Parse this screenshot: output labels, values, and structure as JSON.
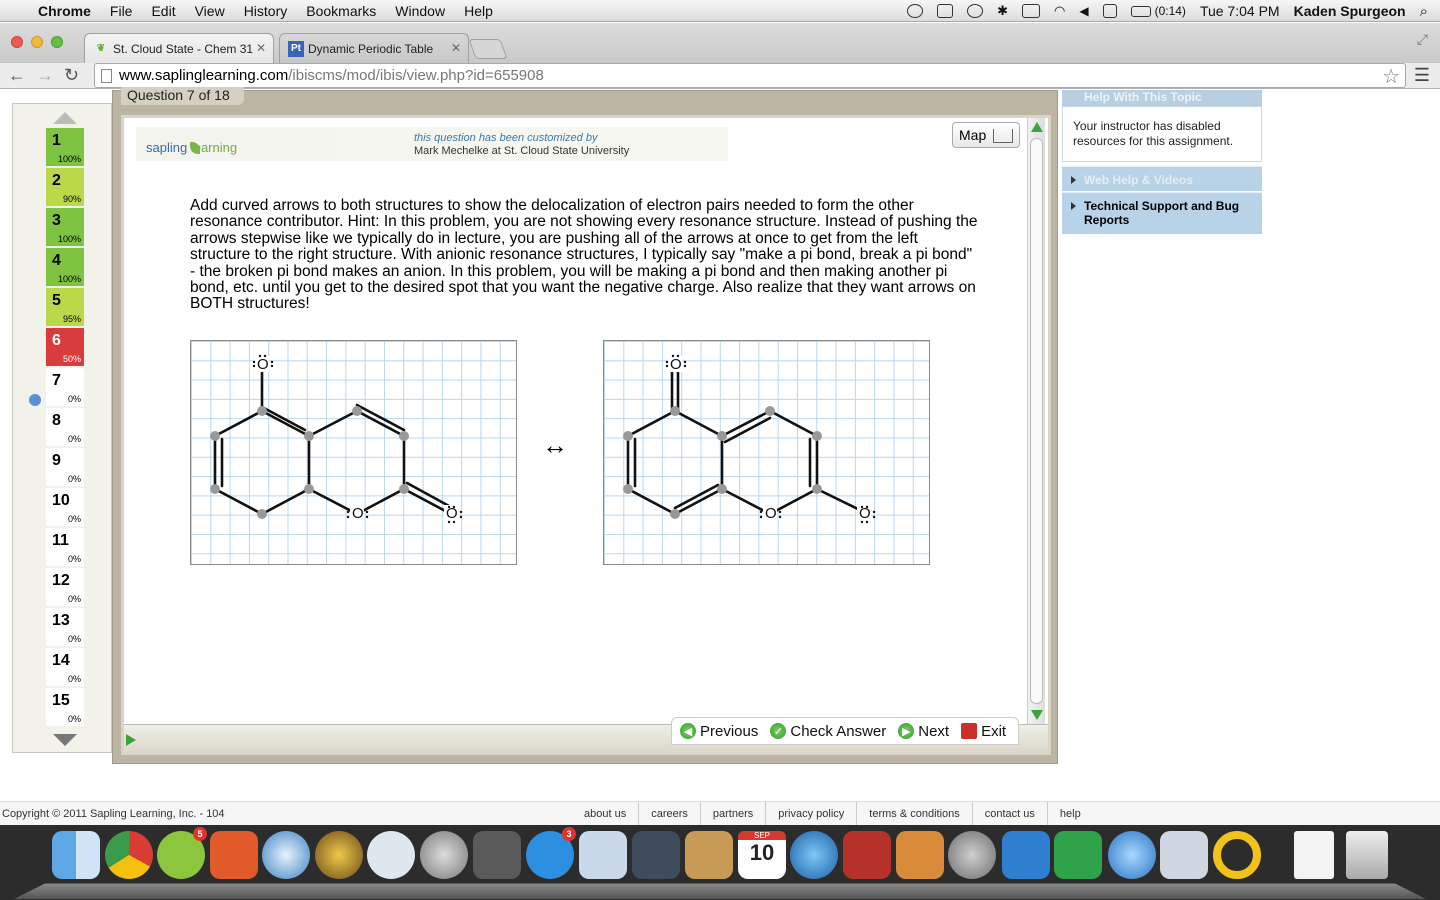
{
  "menubar": {
    "app": "Chrome",
    "menus": [
      "File",
      "Edit",
      "View",
      "History",
      "Bookmarks",
      "Window",
      "Help"
    ],
    "battery": "(0:14)",
    "clock": "Tue 7:04 PM",
    "user": "Kaden Spurgeon"
  },
  "tabs": [
    {
      "title": "St. Cloud State - Chem 31",
      "favicon": "leaf-icon",
      "active": true
    },
    {
      "title": "Dynamic Periodic Table",
      "favicon_text": "Pt",
      "active": false
    }
  ],
  "omnibox": {
    "host": "www.saplinglearning.com",
    "path": "/ibiscms/mod/ibis/view.php?id=655908"
  },
  "question_nav": {
    "items": [
      {
        "num": "1",
        "pct": "100%",
        "status": "green"
      },
      {
        "num": "2",
        "pct": "90%",
        "status": "ygreen"
      },
      {
        "num": "3",
        "pct": "100%",
        "status": "green"
      },
      {
        "num": "4",
        "pct": "100%",
        "status": "green"
      },
      {
        "num": "5",
        "pct": "95%",
        "status": "ygreen"
      },
      {
        "num": "6",
        "pct": "50%",
        "status": "red"
      },
      {
        "num": "7",
        "pct": "0%",
        "status": "empty"
      },
      {
        "num": "8",
        "pct": "0%",
        "status": "empty"
      },
      {
        "num": "9",
        "pct": "0%",
        "status": "empty"
      },
      {
        "num": "10",
        "pct": "0%",
        "status": "empty"
      },
      {
        "num": "11",
        "pct": "0%",
        "status": "empty"
      },
      {
        "num": "12",
        "pct": "0%",
        "status": "empty"
      },
      {
        "num": "13",
        "pct": "0%",
        "status": "empty"
      },
      {
        "num": "14",
        "pct": "0%",
        "status": "empty"
      },
      {
        "num": "15",
        "pct": "0%",
        "status": "empty"
      }
    ]
  },
  "question": {
    "label": "Question 7 of 18",
    "logo_sapling": "sapling",
    "logo_learning": "learning",
    "customized_line1": "this question has been customized by",
    "customized_line2": "Mark Mechelke at St. Cloud State University",
    "map_label": "Map",
    "text": "Add curved arrows to both structures to show the delocalization of electron pairs needed to form the other resonance contributor.  Hint:  In this problem, you are not showing every resonance structure.  Instead of pushing the arrows stepwise like we typically do in lecture, you are pushing all of the arrows at once to get from the left structure to the right structure.  With anionic resonance structures, I typically say \"make a pi bond, break a pi bond\" - the broken pi bond makes an anion.  In this problem, you will be making a pi bond and then making another pi bond, etc. until you get to the desired spot that you want the negative charge.  Also realize that they want arrows on BOTH structures!",
    "resonance_arrow": "↔",
    "atom_label_o": "O"
  },
  "actions": {
    "previous": "Previous",
    "check": "Check Answer",
    "next": "Next",
    "exit": "Exit"
  },
  "sidebar": {
    "help_heading": "Help With This Topic",
    "help_body": "Your instructor has disabled resources for this assignment.",
    "web_help": "Web Help & Videos",
    "tech_support": "Technical Support and Bug Reports"
  },
  "footer": {
    "copyright": "Copyright © 2011 Sapling Learning, Inc. - 104",
    "links": [
      "about us",
      "careers",
      "partners",
      "privacy policy",
      "terms & conditions",
      "contact us",
      "help"
    ]
  },
  "dock": {
    "spotify_badge": "5",
    "appstore_badge": "3",
    "calendar_month": "SEP",
    "calendar_day": "10"
  }
}
